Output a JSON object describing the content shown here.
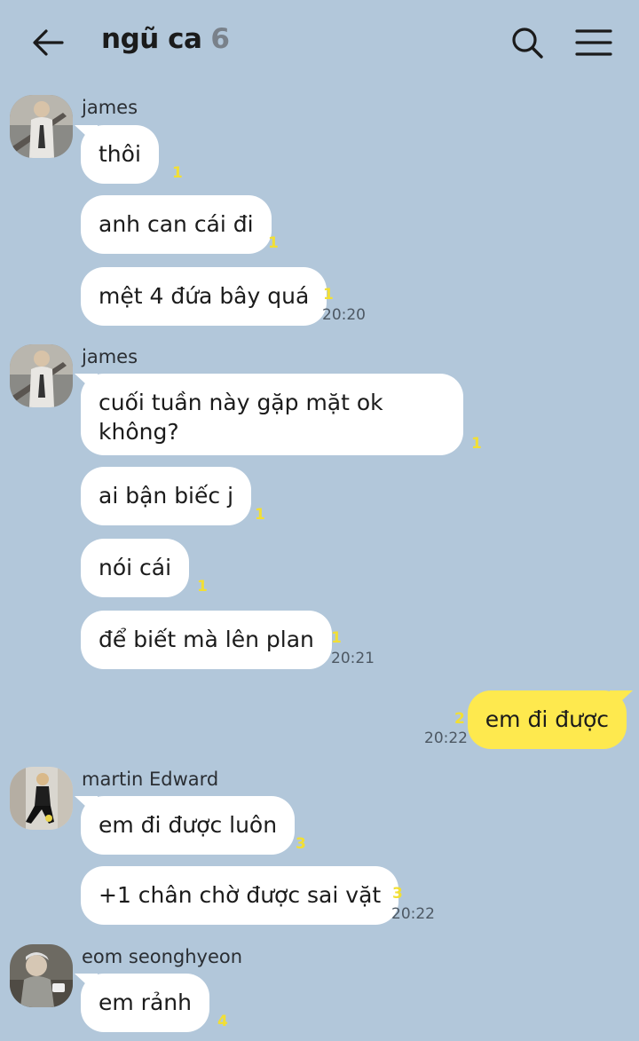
{
  "header": {
    "title": "ngũ ca",
    "member_count": "6",
    "back_icon": "arrow-left-icon",
    "search_icon": "search-icon",
    "menu_icon": "hamburger-menu-icon"
  },
  "colors": {
    "background": "#b2c7da",
    "incoming_bubble": "#ffffff",
    "outgoing_bubble": "#fee94e",
    "unread_count": "#f2df34"
  },
  "messages": {
    "g1": {
      "sender": "james",
      "m1": {
        "text": "thôi",
        "unread": "1"
      },
      "m2": {
        "text": "anh can cái đi",
        "unread": "1"
      },
      "m3": {
        "text": "mệt 4 đứa bây quá",
        "unread": "1",
        "time": "20:20"
      }
    },
    "g2": {
      "sender": "james",
      "m1": {
        "text": "cuối tuần này gặp mặt ok không?",
        "unread": "1"
      },
      "m2": {
        "text": "ai bận biếc j",
        "unread": "1"
      },
      "m3": {
        "text": "nói cái",
        "unread": "1"
      },
      "m4": {
        "text": "để biết mà lên plan",
        "unread": "1",
        "time": "20:21"
      }
    },
    "mine": {
      "m1": {
        "text": "em đi được",
        "unread": "2",
        "time": "20:22"
      }
    },
    "g3": {
      "sender": "martin Edward",
      "m1": {
        "text": "em đi được luôn",
        "unread": "3"
      },
      "m2": {
        "text": "+1 chân chờ được sai vặt",
        "unread": "3",
        "time": "20:22"
      }
    },
    "g4": {
      "sender": "eom seonghyeon",
      "m1": {
        "text": "em rảnh",
        "unread": "4"
      }
    }
  }
}
